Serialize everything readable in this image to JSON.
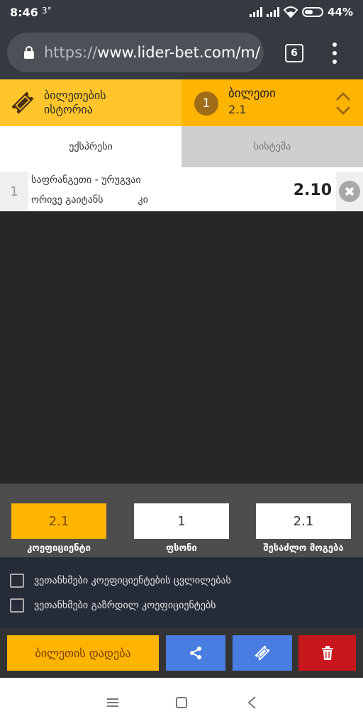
{
  "status_bar": {
    "time": "8:46",
    "temperature": "3°",
    "battery": "44%"
  },
  "browser": {
    "url_protocol": "https://",
    "url_host": "www.lider-bet.com/m/",
    "tab_count": "6"
  },
  "ticket_header": {
    "history_label": "ბილეთების ისტორია",
    "ticket_number": "1",
    "ticket_title": "ბილეთი",
    "ticket_odds": "2.1"
  },
  "tabs": [
    {
      "label": "ექსპრესი",
      "active": true
    },
    {
      "label": "სისტემა",
      "active": false
    }
  ],
  "bets": [
    {
      "index": "1",
      "match": "საფრანგეთი - ურუგვაი",
      "market": "ორივე გაიტანს           კი",
      "odd": "2.10"
    }
  ],
  "summary": {
    "odds_value": "2.1",
    "odds_label": "კოეფიციენტი",
    "stake_value": "1",
    "stake_label": "ფსონი",
    "win_value": "2.1",
    "win_label": "შესაძლო მოგება"
  },
  "agreements": [
    {
      "label": "ვეთანხმები კოეფიციენტების ცვლილებას",
      "checked": false
    },
    {
      "label": "ვეთანხმები გაზრდილ კოეფიციენტებს",
      "checked": false
    }
  ],
  "actions": {
    "place_label": "ბილეთის დადება"
  },
  "colors": {
    "accent": "#ffb400",
    "history_yellow": "#ffc52b",
    "primary_blue": "#4a7de2",
    "danger_red": "#c8161d",
    "dark_bg": "#272727"
  }
}
